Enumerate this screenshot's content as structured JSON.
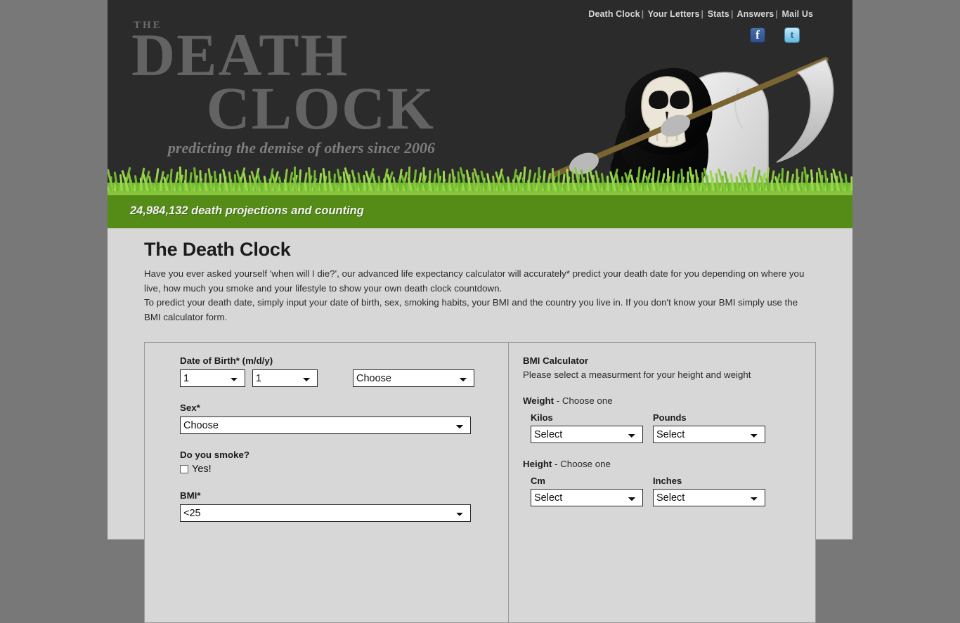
{
  "site": {
    "logo_the": "THE",
    "logo_line1": "DEATH",
    "logo_line2": "CLOCK",
    "logo_tagline": "predicting the demise of others since 2006",
    "counter_text": "24,984,132 death projections and counting"
  },
  "topnav": {
    "items": [
      "Death Clock",
      "Your Letters",
      "Stats",
      "Answers",
      "Mail Us"
    ],
    "separator": "|"
  },
  "social": {
    "facebook_label": "f",
    "twitter_label": "t"
  },
  "main": {
    "title": "The Death Clock",
    "paragraph1": "Have you ever asked yourself 'when will I die?', our advanced life expectancy calculator will accurately* predict your death date for you depending on where you live, how much you smoke and your lifestyle to show your own death clock countdown.",
    "paragraph2": "To predict your death date, simply input your date of birth, sex, smoking habits, your BMI and the country you live in. If you don't know your BMI simply use the BMI calculator form."
  },
  "form": {
    "dob_label": "Date of Birth* (m/d/y)",
    "dob_month_value": "1",
    "dob_day_value": "1",
    "dob_year_value": "Choose",
    "sex_label": "Sex*",
    "sex_value": "Choose",
    "smoke_label": "Do you smoke?",
    "smoke_checkbox_label": "Yes!",
    "smoke_checked": false,
    "bmi_label": "BMI*",
    "bmi_value": "<25"
  },
  "bmi_calculator": {
    "heading": "BMI Calculator",
    "subheading": "Please select a measurment for your height and weight",
    "weight_label": "Weight",
    "weight_hint": " - Choose one",
    "kilos_label": "Kilos",
    "kilos_value": "Select",
    "pounds_label": "Pounds",
    "pounds_value": "Select",
    "height_label": "Height",
    "height_hint": " - Choose one",
    "cm_label": "Cm",
    "cm_value": "Select",
    "inches_label": "Inches",
    "inches_value": "Select"
  },
  "colors": {
    "page_bg": "#787878",
    "content_bg": "#d7d7d7",
    "header_bg": "#2b2b2b",
    "green_bar": "#558b17",
    "grass_green": "#7ac943",
    "facebook_blue": "#3b5998",
    "twitter_blue": "#9ad5ef"
  }
}
